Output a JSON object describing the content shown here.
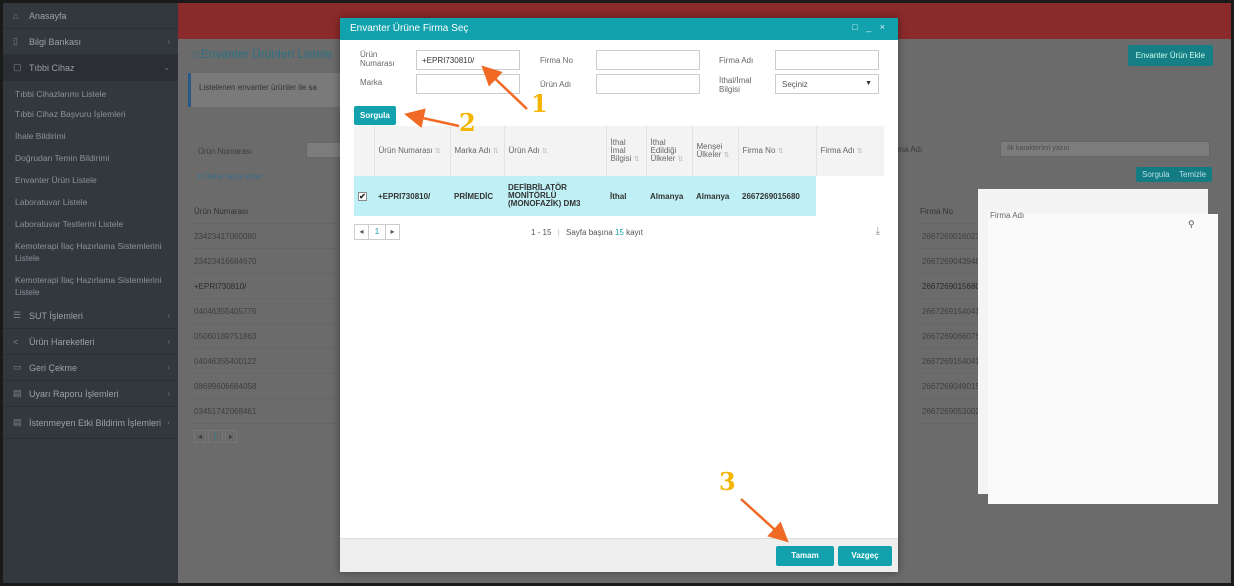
{
  "sidebar": {
    "items": [
      {
        "label": "Anasayfa",
        "icon": "home-icon"
      },
      {
        "label": "Bilgi Bankası",
        "icon": "book-icon"
      },
      {
        "label": "Tıbbi Cihaz",
        "icon": "device-icon"
      }
    ],
    "sub_items": [
      "Tıbbi Cihazlarımı Listele",
      "Tıbbi Cihaz Başvuru İşlemleri",
      "İhale Bildirimi",
      "Doğrudan Temin Bildirimi",
      "Envanter Ürün Listele",
      "Laboratuvar Listele",
      "Laboratuvar Testlerini Listele",
      "Kemoterapi İlaç Hazırlama Sistemlerini Listele",
      "Kemoterapi İlaç Hazırlama Sistemlerini Listele"
    ],
    "bottom_items": [
      {
        "label": "SUT İşlemleri",
        "icon": "list-icon"
      },
      {
        "label": "Ürün Hareketleri",
        "icon": "share-icon"
      },
      {
        "label": "Geri Çekme",
        "icon": "box-icon"
      },
      {
        "label": "Uyarı Raporu İşlemleri",
        "icon": "report-icon"
      },
      {
        "label": "İstenmeyen Etki Bildirim İşlemleri",
        "icon": "warning-icon"
      }
    ]
  },
  "page": {
    "title": "☆Envanter Ürünleri Listele",
    "add_button": "Envanter Ürün Ekle",
    "info_text": "Listelenen envanter ürünler ile sa",
    "filter_label": "Ürün Numarası",
    "more_filters": "▾ Daha fazla kriter",
    "firma_adi_label": "Firma Adı",
    "search_placeholder": "İlk karakterleri yazın",
    "search_button": "Sorgula",
    "clear_button": "Temizle",
    "column_urun_numarasi": "Ürün Numarası",
    "column_firma_no": "Firma No",
    "column_firma_adi": "Firma Adı",
    "rows_left": [
      "23423417060080",
      "23423416684670",
      "+EPRI730810/",
      "04046355405776",
      "05060189751863",
      "04046355400122",
      "08699606684058",
      "03451742068461"
    ],
    "rows_right": [
      "2667269016023",
      "2667269043948",
      "2667269015680",
      "2667269154041",
      "2667269066075",
      "2667269154041",
      "2667269049015",
      "2667269053002"
    ],
    "pager_page": "1"
  },
  "modal": {
    "title": "Envanter Ürüne Firma Seç",
    "window_controls": "□ _ ×",
    "labels": {
      "urun_numarasi": "Ürün Numarası",
      "marka": "Marka",
      "firma_no": "Firma No",
      "urun_adi": "Ürün Adı",
      "firma_adi": "Firma Adı",
      "ithal_imal_bilgisi": "İthal/İmal Bilgisi"
    },
    "inputs": {
      "urun_numarasi": "+EPRI730810/",
      "marka": "",
      "firma_no": "",
      "urun_adi": "",
      "firma_adi": ""
    },
    "select_value": "Seçiniz",
    "search_button": "Sorgula",
    "table": {
      "columns": [
        "Ürün Numarası",
        "Marka Adı",
        "Ürün Adı",
        "İthal İmal Bilgisi",
        "İthal Edildiği Ülkeler",
        "Menşei Ülkeler",
        "Firma No",
        "Firma Adı"
      ],
      "rows": [
        {
          "urun_numarasi": "+EPRI730810/",
          "marka_adi": "PRİMEDİC",
          "urun_adi": "DEFİBRİLATÖR MONİTÖRLÜ (MONOFAZİK) DM3",
          "ithal_imal": "İthal",
          "ithal_ulke": "Almanya",
          "mensei_ulke": "Almanya",
          "firma_no": "2667269015680",
          "firma_adi": "",
          "selected": true
        }
      ]
    },
    "pager": {
      "current_page": "1",
      "range": "1 - 15",
      "per_page_text": "Sayfa başına",
      "per_page_value": "15",
      "per_page_suffix": "kayıt"
    },
    "ok_button": "Tamam",
    "cancel_button": "Vazgeç"
  },
  "annotations": {
    "step1": "1",
    "step2": "2",
    "step3": "3",
    "color": "#f4b400",
    "arrow_color": "#f06a25"
  }
}
